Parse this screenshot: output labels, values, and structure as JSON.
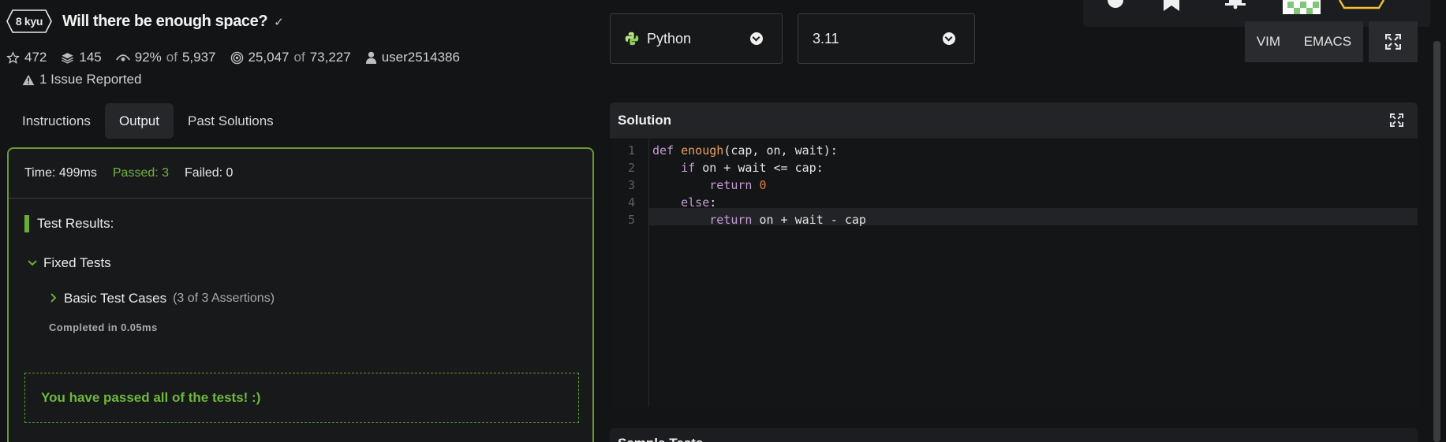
{
  "kata": {
    "rank": "8 kyu",
    "title": "Will there be enough space?",
    "completed_mark": "✓"
  },
  "stats": {
    "stars": "472",
    "collections": "145",
    "satisfaction_pct": "92%",
    "satisfaction_of": "of",
    "satisfaction_votes": "5,937",
    "completions": "25,047",
    "completions_of": "of",
    "attempts": "73,227",
    "author": "user2514386"
  },
  "issues": "1 Issue Reported",
  "tabs": [
    {
      "label": "Instructions",
      "active": false
    },
    {
      "label": "Output",
      "active": true
    },
    {
      "label": "Past Solutions",
      "active": false
    }
  ],
  "output": {
    "time": "Time: 499ms",
    "passed": "Passed: 3",
    "failed": "Failed: 0",
    "results_heading": "Test Results:",
    "group_label": "Fixed Tests",
    "case_label": "Basic Test Cases",
    "case_assertions": "(3 of 3 Assertions)",
    "completed_in": "Completed in 0.05ms",
    "all_passed": "You have passed all of the tests! :)"
  },
  "editor": {
    "language": "Python",
    "version": "3.11",
    "modes": [
      "VIM",
      "EMACS"
    ],
    "solution_title": "Solution",
    "sample_tests_title": "Sample Tests",
    "current_line": 5,
    "line_numbers": [
      "1",
      "2",
      "3",
      "4",
      "5"
    ]
  },
  "colors": {
    "accent_green": "#6aab34",
    "background": "#131416",
    "panel": "#1c1d20"
  }
}
